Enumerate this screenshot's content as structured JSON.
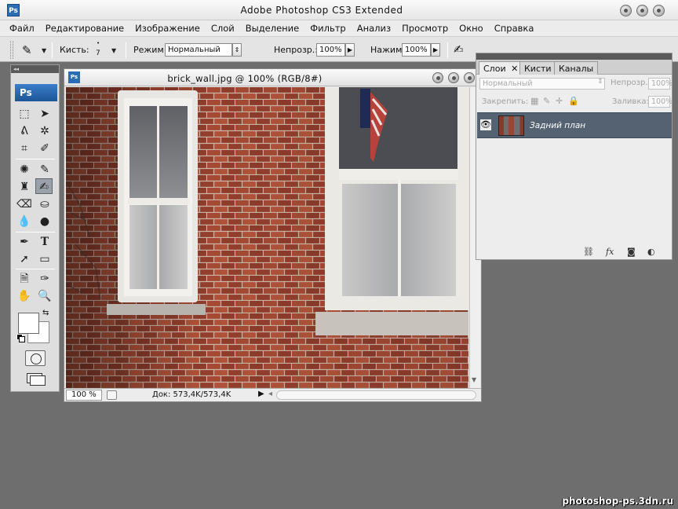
{
  "app": {
    "title": "Adobe Photoshop CS3 Extended",
    "logo": "Ps"
  },
  "menu": [
    "Файл",
    "Редактирование",
    "Изображение",
    "Слой",
    "Выделение",
    "Фильтр",
    "Анализ",
    "Просмотр",
    "Окно",
    "Справка"
  ],
  "options": {
    "brush_label": "Кисть:",
    "brush_size": "7",
    "mode_label": "Режим:",
    "mode_value": "Нормальный",
    "opacity_label": "Непрозр.:",
    "opacity_value": "100%",
    "pressure_label": "Нажим:",
    "pressure_value": "100%"
  },
  "toolbox": {
    "logo": "Ps",
    "collapse": "◂◂"
  },
  "document": {
    "title": "brick_wall.jpg @ 100% (RGB/8#)",
    "icon": "Ps",
    "zoom": "100 %",
    "info": "Док: 573,4K/573,4K"
  },
  "layers": {
    "tabs": [
      "Слои",
      "Кисти",
      "Каналы"
    ],
    "blend_mode": "Нормальный",
    "opacity_label": "Непрозр.:",
    "opacity_value": "100%",
    "lock_label": "Закрепить:",
    "fill_label": "Заливка:",
    "fill_value": "100%",
    "layer_name": "Задний план"
  },
  "watermark": "photoshop-ps.3dn.ru",
  "colors": {
    "layer_selected": "#546272",
    "brick": "#9b4632",
    "ps_blue": "#2a6db5"
  }
}
